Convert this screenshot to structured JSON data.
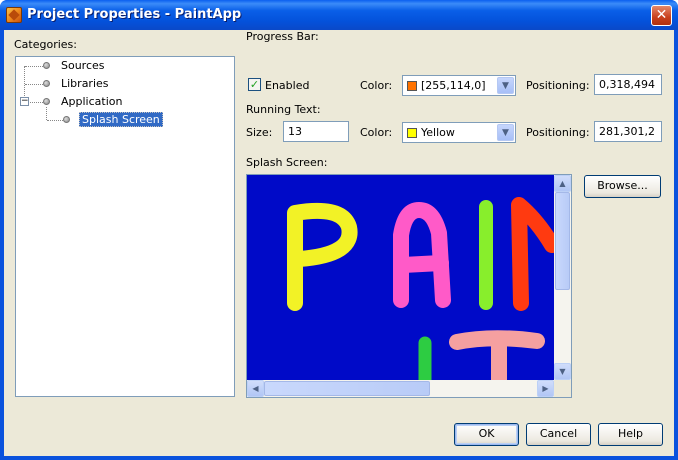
{
  "window": {
    "title": "Project Properties - PaintApp"
  },
  "categories": {
    "label": "Categories:",
    "items": [
      {
        "label": "Sources"
      },
      {
        "label": "Libraries"
      },
      {
        "label": "Application"
      },
      {
        "label": "Splash Screen"
      }
    ],
    "selected": "Splash Screen"
  },
  "progress_bar": {
    "section_label": "Progress Bar:",
    "enabled_label": "Enabled",
    "enabled": true,
    "color_label": "Color:",
    "color_value": "[255,114,0]",
    "color_swatch": "#ff7200",
    "positioning_label": "Positioning:",
    "positioning_value": "0,318,494"
  },
  "running_text": {
    "section_label": "Running Text:",
    "size_label": "Size:",
    "size_value": "13",
    "color_label": "Color:",
    "color_value": "Yellow",
    "color_swatch": "#ffff00",
    "positioning_label": "Positioning:",
    "positioning_value": "281,301,2"
  },
  "splash": {
    "section_label": "Splash Screen:",
    "browse_label": "Browse...",
    "background_color": "#000ac8"
  },
  "footer": {
    "ok_label": "OK",
    "cancel_label": "Cancel",
    "help_label": "Help"
  },
  "icons": {
    "app_icon": "paint-app-icon",
    "close": "close-icon",
    "check": "check-icon",
    "combo_arrow": "chevron-down-icon"
  }
}
